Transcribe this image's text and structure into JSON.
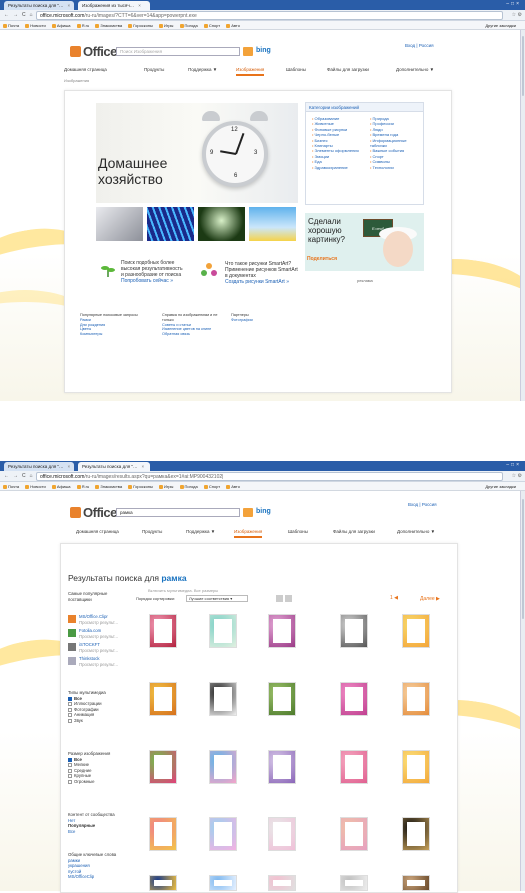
{
  "colors": {
    "accent": "#e8731a",
    "link": "#1a5fb4",
    "tabbar": "#2a5da8",
    "bing": "#1a73c0"
  },
  "shot1": {
    "tabs": [
      "Результаты поиска для \"…",
      "Изображения из тысяч…"
    ],
    "url_host": "office.microsoft.com",
    "url_rest": "/ru-ru/images/?CTT=6&ver=14&app=powerpnt.exe",
    "bookmarks": [
      "Почта",
      "Новости",
      "Афиша",
      "Я.ru",
      "Знакомства",
      "Гороскопы",
      "Игры",
      "Погода",
      "Спорт",
      "Авто"
    ],
    "bookmarks_other": "Другие закладки",
    "logo": "Office",
    "search_placeholder": "Поиск Изображения",
    "bing": "bing",
    "header_links": "Вход  |  Россия",
    "nav": [
      "Домашняя страница",
      "Продукты",
      "Поддержка ▼",
      "Изображения",
      "Шаблоны",
      "Файлы для загрузки",
      "Дополнительно ▼"
    ],
    "crumb": "Изображения",
    "hero_title_1": "Домашнее",
    "hero_title_2": "хозяйство",
    "categories_header": "Категории изображений",
    "categories_left": [
      "Образование",
      "Животные",
      "Фоновые рисунки",
      "Черно-белые",
      "Бизнес",
      "Клипарты",
      "Элементы оформления",
      "Эмоции",
      "Еда",
      "Здравоохранение"
    ],
    "categories_right": [
      "Природа",
      "Профессии",
      "Люди",
      "Времена года",
      "Информационные таблички",
      "Важные события",
      "Спорт",
      "Символы",
      "Технологии"
    ],
    "promo_q": "Сделали хорошую картинку?",
    "promo_btn": "Поделиться",
    "promo_board": "E=mc²",
    "ad_label": "реклама",
    "feat1": "Поиск подобных более высокая результативность и разнообразие от поиска",
    "feat1_link": "Попробовать сейчас »",
    "feat2_title": "Что такое рисунки SmartArt?",
    "feat2_text": "Применение рисунков SmartArt в документах",
    "feat2_link": "Создать рисунки SmartArt »",
    "foot1_h": "Популярные поисковые запросы",
    "foot1": [
      "Рамки",
      "Дни рождения",
      "Цветы",
      "Компьютеры"
    ],
    "foot2_h": "Справка по изображениям и не только",
    "foot2": [
      "Советы и статьи",
      "Изменение цветов на клипе",
      "Обратная связь"
    ],
    "foot3_h": "Партнеры",
    "foot3": [
      "Фотографии"
    ]
  },
  "shot2": {
    "tabs": [
      "Результаты поиска для \"…",
      "Результаты поиска для \"…"
    ],
    "url_host": "office.microsoft.com",
    "url_rest": "/ru-ru/images/results.aspx?qu=рамка&ex=1#ai:MP900432102|",
    "bookmarks": [
      "Почта",
      "Новости",
      "Афиша",
      "Я.ru",
      "Знакомства",
      "Гороскопы",
      "Игры",
      "Погода",
      "Спорт",
      "Авто"
    ],
    "bookmarks_other": "Другие закладки",
    "logo": "Office",
    "search_value": "рамка",
    "bing": "bing",
    "header_links": "Вход  |  Россия",
    "nav": [
      "Домашняя страница",
      "Продукты",
      "Поддержка ▼",
      "Изображения",
      "Шаблоны",
      "Файлы для загрузки",
      "Дополнительно ▼"
    ],
    "results_prefix": "Результаты поиска для",
    "results_query": "рамка",
    "filters_hint": "Включить мультимедиа. Все размеры",
    "sort_label": "Порядок сортировки:",
    "sort_value": "Лучшие соответствия",
    "pager_next": "Далее ▶",
    "pager_nums": "1 ◀",
    "pop_h": "Самые популярные поставщики",
    "providers": [
      {
        "name": "MS/Office.Clipr",
        "sub": "Просмотр результ..."
      },
      {
        "name": "Fotolia.com",
        "sub": "Просмотр результ..."
      },
      {
        "name": "iSTOCKFT",
        "sub": "Просмотр результ..."
      },
      {
        "name": "Thinkstock",
        "sub": "Просмотр результ..."
      }
    ],
    "media_h": "Типы мультимедиа",
    "media": [
      "Все",
      "Иллюстрации",
      "Фотографии",
      "Анимация",
      "Звук"
    ],
    "size_h": "Размер изображения",
    "sizes": [
      "Все",
      "Мелкие",
      "Средние",
      "Крупные",
      "Огромные"
    ],
    "comm_h": "Контент от сообщества",
    "comm": [
      "Нет",
      "Популярные",
      "Все"
    ],
    "kw_h": "Общие ключевые слова",
    "kw": [
      "рамки",
      "украшения",
      "пустой",
      "MS/OfficeClip"
    ]
  }
}
